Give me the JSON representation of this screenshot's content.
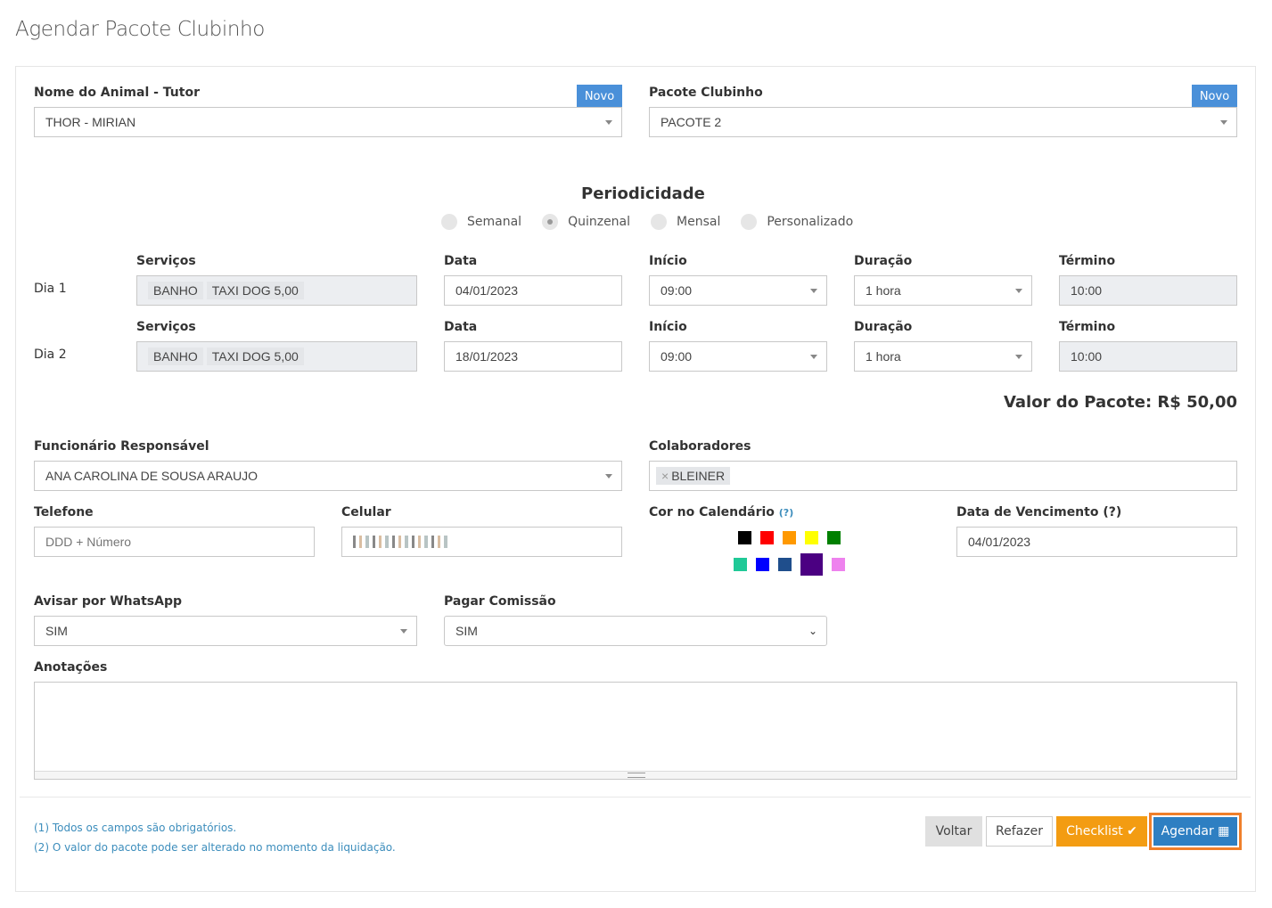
{
  "page_title": "Agendar Pacote Clubinho",
  "animal": {
    "label": "Nome do Animal - Tutor",
    "novo": "Novo",
    "value": "THOR - MIRIAN"
  },
  "pacote": {
    "label": "Pacote Clubinho",
    "novo": "Novo",
    "value": "PACOTE 2"
  },
  "periodicidade": {
    "title": "Periodicidade",
    "options": [
      "Semanal",
      "Quinzenal",
      "Mensal",
      "Personalizado"
    ],
    "selected": "Quinzenal"
  },
  "headers": {
    "servicos": "Serviços",
    "data": "Data",
    "inicio": "Início",
    "duracao": "Duração",
    "termino": "Término"
  },
  "days": [
    {
      "label": "Dia 1",
      "servicos": [
        "BANHO",
        "TAXI DOG 5,00"
      ],
      "data": "04/01/2023",
      "inicio": "09:00",
      "duracao": "1 hora",
      "termino": "10:00"
    },
    {
      "label": "Dia 2",
      "servicos": [
        "BANHO",
        "TAXI DOG 5,00"
      ],
      "data": "18/01/2023",
      "inicio": "09:00",
      "duracao": "1 hora",
      "termino": "10:00"
    }
  ],
  "valor_pacote": "Valor do Pacote: R$ 50,00",
  "funcionario": {
    "label": "Funcionário Responsável",
    "value": "ANA CAROLINA DE SOUSA ARAUJO"
  },
  "colaboradores": {
    "label": "Colaboradores",
    "tag_remove": "×",
    "tag": "BLEINER"
  },
  "telefone": {
    "label": "Telefone",
    "placeholder": "DDD + Número"
  },
  "celular": {
    "label": "Celular"
  },
  "cor": {
    "label": "Cor no Calendário",
    "help": "(?)",
    "colors": [
      "#000000",
      "#ff0000",
      "#ff9900",
      "#ffff00",
      "#008000",
      "#20c997",
      "#0000ff",
      "#1f4e8c",
      "#4b0082",
      "#ee82ee"
    ],
    "selected": "#4b0082"
  },
  "vencimento": {
    "label": "Data de Vencimento (?)",
    "value": "04/01/2023"
  },
  "whatsapp": {
    "label": "Avisar por WhatsApp",
    "value": "SIM"
  },
  "comissao": {
    "label": "Pagar Comissão",
    "value": "SIM"
  },
  "anotacoes": {
    "label": "Anotações"
  },
  "notes": [
    "(1) Todos os campos são obrigatórios.",
    "(2) O valor do pacote pode ser alterado no momento da liquidação."
  ],
  "buttons": {
    "voltar": "Voltar",
    "refazer": "Refazer",
    "checklist": "Checklist ✔",
    "agendar": "Agendar ▦"
  },
  "accent": {
    "blue": "#2e7fc2",
    "orange": "#f39c12",
    "novo": "#4a90d9"
  }
}
